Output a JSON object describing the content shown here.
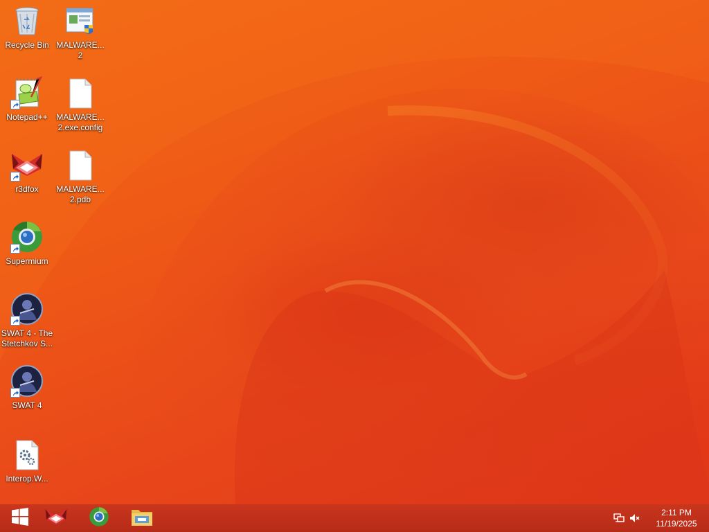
{
  "desktop": {
    "icons": [
      {
        "label": "Recycle Bin",
        "icon": "recycle-bin-icon"
      },
      {
        "label": "MALWARE...\n2",
        "icon": "application-window-icon"
      },
      {
        "label": "Notepad++",
        "icon": "notepad-plus-plus-icon"
      },
      {
        "label": "MALWARE...\n2.exe.config",
        "icon": "blank-file-icon"
      },
      {
        "label": "r3dfox",
        "icon": "r3dfox-icon"
      },
      {
        "label": "MALWARE...\n2.pdb",
        "icon": "blank-file-icon"
      },
      {
        "label": "Supermium",
        "icon": "supermium-browser-icon"
      },
      {
        "label": "SWAT 4 - The\nStetchkov S...",
        "icon": "swat4-game-icon"
      },
      {
        "label": "SWAT 4",
        "icon": "swat4-game-icon"
      },
      {
        "label": "Interop.W...",
        "icon": "dll-settings-file-icon"
      }
    ]
  },
  "taskbar": {
    "start": {
      "icon": "windows-start-icon"
    },
    "pinned": [
      {
        "icon": "r3dfox-icon"
      },
      {
        "icon": "supermium-browser-icon"
      },
      {
        "icon": "file-explorer-icon"
      }
    ],
    "tray": {
      "network_icon": "network-icon",
      "volume_icon": "volume-muted-icon",
      "time": "2:11 PM",
      "date": "11/19/2025"
    }
  },
  "colors": {
    "wallpaper": "#ef5a16",
    "taskbar": "#bd301b",
    "text": "#ffffff"
  }
}
